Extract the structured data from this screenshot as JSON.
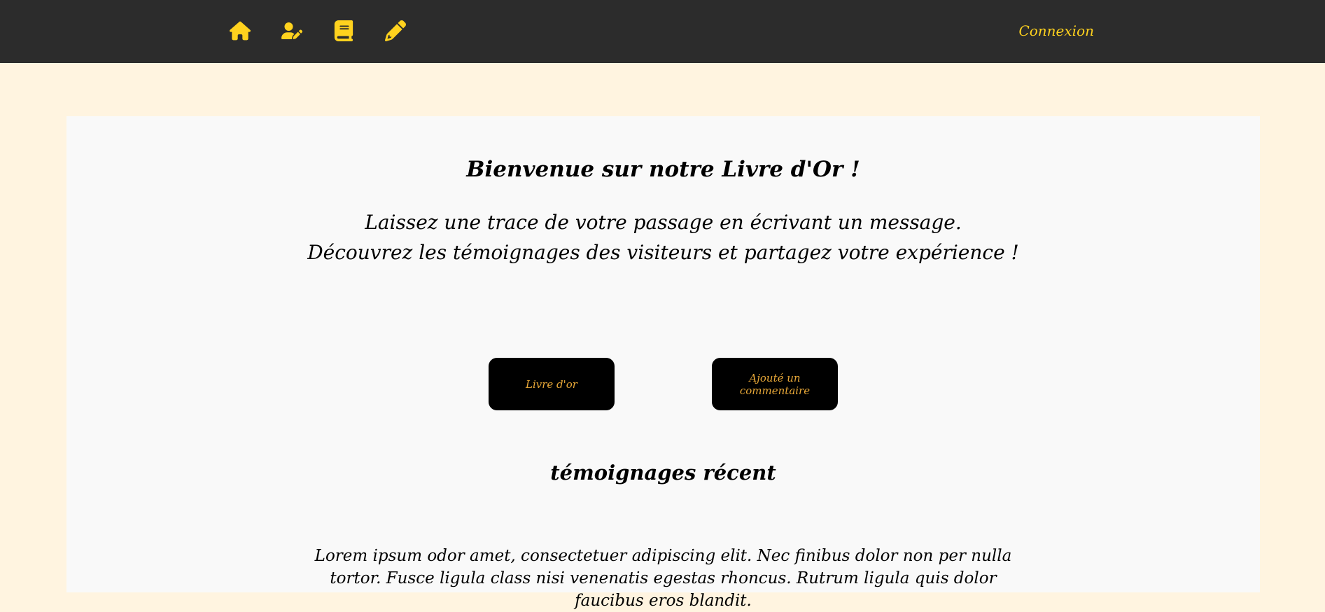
{
  "nav": {
    "icons": [
      "home-icon",
      "user-edit-icon",
      "book-icon",
      "pencil-icon"
    ],
    "login_label": "Connexion",
    "bg_color": "#2c2c2c",
    "accent_color": "#ffd21e"
  },
  "main": {
    "welcome": "Bienvenue sur notre Livre d'Or !",
    "intro_line1": "Laissez une trace de votre passage en écrivant un message.",
    "intro_line2": "Découvrez les témoignages des visiteurs et partagez votre expérience !",
    "buttons": {
      "livre_or": "Livre d'or",
      "add_comment": "Ajouté un commentaire"
    },
    "recent_title": "témoignages récent",
    "testimonial": "Lorem ipsum odor amet, consectetuer adipiscing elit. Nec finibus dolor non per nulla tortor. Fusce ligula class nisi venenatis egestas rhoncus. Rutrum ligula quis dolor faucibus eros blandit."
  }
}
